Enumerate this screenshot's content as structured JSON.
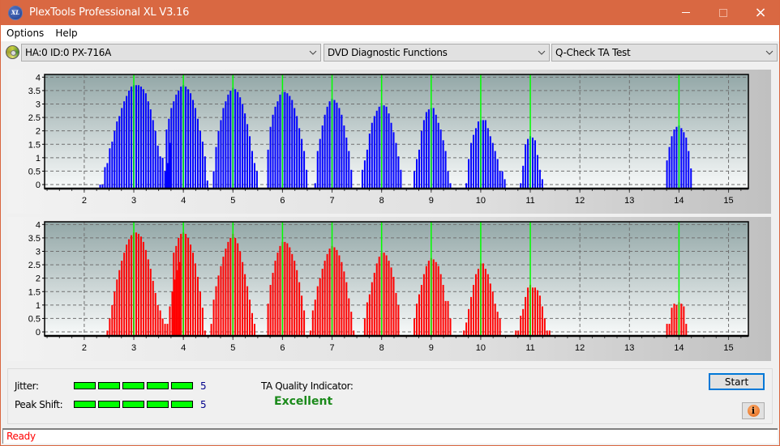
{
  "window": {
    "title": "PlexTools Professional XL V3.16",
    "icon": "xl-logo-icon",
    "app_icon_text": "XL",
    "controls": {
      "minimize": "minimize-icon",
      "maximize": "maximize-icon",
      "close": "×"
    }
  },
  "menu": {
    "items": [
      {
        "label": "Options"
      },
      {
        "label": "Help"
      }
    ]
  },
  "toolbar": {
    "drive_select": "HA:0 ID:0  PX-716A",
    "function_select": "DVD Diagnostic Functions",
    "test_select": "Q-Check TA Test"
  },
  "colors": {
    "titlebar": "#d96842",
    "land_bars": "#0000ff",
    "pit_bars": "#ff0000",
    "reference_lines": "#00ff00",
    "quality_text": "#1b8a1b",
    "status_text": "#ff0000",
    "meter_fill": "#00ff00"
  },
  "chart_data": [
    {
      "type": "bar",
      "name": "top-histogram",
      "color": "#0000ff",
      "xlim": [
        1.2,
        15.4
      ],
      "ylim": [
        -0.15,
        4.1
      ],
      "x_ticks": [
        2,
        3,
        4,
        5,
        6,
        7,
        8,
        9,
        10,
        11,
        12,
        13,
        14,
        15
      ],
      "y_ticks": [
        0,
        0.5,
        1,
        1.5,
        2,
        2.5,
        3,
        3.5,
        4
      ],
      "y_tick_labels": [
        "0",
        "0.5",
        "1",
        "1.5",
        "2",
        "2.5",
        "3",
        "3.5",
        "4"
      ],
      "reference_lines": [
        3,
        4,
        5,
        6,
        7,
        8,
        9,
        10,
        11,
        14
      ],
      "grid": true,
      "peaks": [
        {
          "center": 3.0,
          "values": [
            0,
            0,
            0.65,
            0.8,
            1.35,
            1.6,
            2.0,
            2.35,
            2.55,
            2.85,
            3.1,
            3.3,
            3.5,
            3.65,
            3.7,
            3.7,
            3.7,
            3.65,
            3.55,
            3.4,
            3.1,
            2.8,
            2.4,
            2.0,
            1.45,
            1.05,
            1.0,
            0.5,
            0.8,
            1.55
          ]
        },
        {
          "center": 4.0,
          "values": [
            2.05,
            2.45,
            2.85,
            3.1,
            3.35,
            3.5,
            3.65,
            3.7,
            3.65,
            3.55,
            3.4,
            3.15,
            2.85,
            2.45,
            2.0,
            1.6,
            1.05,
            0.15
          ]
        },
        {
          "center": 5.0,
          "values": [
            0.5,
            1.4,
            2.0,
            2.4,
            2.85,
            3.1,
            3.35,
            3.5,
            3.6,
            3.55,
            3.45,
            3.25,
            3.0,
            2.65,
            2.25,
            1.8,
            1.25,
            0.8,
            0.5
          ]
        },
        {
          "center": 6.0,
          "values": [
            1.3,
            2.15,
            2.6,
            2.9,
            3.1,
            3.35,
            3.45,
            3.45,
            3.4,
            3.3,
            3.15,
            2.85,
            2.55,
            2.1,
            1.7,
            1.25,
            0.55
          ]
        },
        {
          "center": 7.0,
          "values": [
            0.05,
            1.25,
            1.7,
            2.2,
            2.6,
            2.9,
            3.1,
            3.2,
            3.15,
            3.05,
            2.85,
            2.6,
            2.2,
            1.75,
            1.25,
            0.55
          ]
        },
        {
          "center": 8.0,
          "values": [
            0.55,
            0.9,
            1.3,
            1.9,
            2.3,
            2.55,
            2.75,
            2.9,
            2.95,
            2.95,
            2.9,
            2.65,
            2.3,
            1.95,
            1.55,
            1.05,
            0.55
          ]
        },
        {
          "center": 9.0,
          "values": [
            0.5,
            0.95,
            1.3,
            2.0,
            2.4,
            2.7,
            2.8,
            2.85,
            2.85,
            2.6,
            2.3,
            2.05,
            1.65,
            1.25,
            0.5,
            0.05
          ]
        },
        {
          "center": 10.0,
          "values": [
            0.05,
            0.95,
            1.55,
            1.85,
            2.1,
            2.35,
            2.4,
            2.4,
            2.4,
            2.1,
            1.8,
            1.55,
            1.25,
            0.95,
            0.5,
            0.5,
            0.2
          ]
        },
        {
          "center": 11.0,
          "values": [
            0.05,
            0.7,
            1.5,
            1.7,
            1.8,
            1.75,
            1.65,
            1.1,
            0.55,
            0.2
          ]
        },
        {
          "center": 14.0,
          "values": [
            0.9,
            1.4,
            1.8,
            2.05,
            2.15,
            2.2,
            2.1,
            1.95,
            1.75,
            1.25,
            0.6
          ]
        }
      ]
    },
    {
      "type": "bar",
      "name": "bottom-histogram",
      "color": "#ff0000",
      "xlim": [
        1.2,
        15.4
      ],
      "ylim": [
        -0.15,
        4.1
      ],
      "x_ticks": [
        2,
        3,
        4,
        5,
        6,
        7,
        8,
        9,
        10,
        11,
        12,
        13,
        14,
        15
      ],
      "y_ticks": [
        0,
        0.5,
        1,
        1.5,
        2,
        2.5,
        3,
        3.5,
        4
      ],
      "y_tick_labels": [
        "0",
        "0.5",
        "1",
        "1.5",
        "2",
        "2.5",
        "3",
        "3.5",
        "4"
      ],
      "reference_lines": [
        3,
        4,
        5,
        6,
        7,
        8,
        9,
        10,
        11,
        14
      ],
      "grid": true,
      "peaks": [
        {
          "center": 3.0,
          "values": [
            0.05,
            0.5,
            1.0,
            1.5,
            1.95,
            2.3,
            2.65,
            2.95,
            3.25,
            3.45,
            3.6,
            3.7,
            3.7,
            3.65,
            3.55,
            3.35,
            3.05,
            2.7,
            2.35,
            1.9,
            1.45,
            1.0,
            0.8,
            0.5,
            0.3,
            0.3,
            0.95,
            1.5,
            1.95,
            2.3,
            2.6
          ]
        },
        {
          "center": 4.0,
          "values": [
            2.95,
            3.2,
            3.5,
            3.65,
            3.7,
            3.65,
            3.5,
            3.25,
            2.95,
            2.55,
            2.05,
            1.5,
            0.9,
            0.05
          ]
        },
        {
          "center": 5.0,
          "values": [
            0.3,
            1.2,
            1.7,
            2.1,
            2.45,
            2.8,
            3.1,
            3.35,
            3.5,
            3.65,
            3.5,
            3.3,
            3.0,
            2.6,
            2.15,
            1.7,
            1.2,
            0.7,
            0.3
          ]
        },
        {
          "center": 6.0,
          "values": [
            1.05,
            1.75,
            2.2,
            2.65,
            2.95,
            3.2,
            3.35,
            3.35,
            3.3,
            3.15,
            2.9,
            2.65,
            2.3,
            1.85,
            1.35,
            0.8
          ]
        },
        {
          "center": 7.0,
          "values": [
            0.05,
            0.8,
            1.2,
            1.7,
            2.0,
            2.35,
            2.65,
            2.9,
            3.1,
            3.2,
            3.15,
            3.05,
            2.85,
            2.6,
            2.25,
            1.85,
            1.25,
            0.75,
            0.05
          ]
        },
        {
          "center": 8.0,
          "values": [
            0.5,
            1.1,
            1.4,
            1.85,
            2.2,
            2.55,
            2.8,
            2.95,
            2.95,
            2.85,
            2.65,
            2.4,
            2.05,
            1.45,
            1.0
          ]
        },
        {
          "center": 9.0,
          "values": [
            0.5,
            1.05,
            1.4,
            1.75,
            2.15,
            2.45,
            2.65,
            2.75,
            2.7,
            2.6,
            2.45,
            2.15,
            1.75,
            1.15,
            1.15,
            0.5
          ]
        },
        {
          "center": 10.0,
          "values": [
            0.05,
            0.35,
            0.85,
            1.3,
            1.75,
            2.15,
            2.35,
            2.55,
            2.55,
            2.35,
            2.15,
            1.8,
            1.5,
            1.05,
            0.75,
            0.5
          ]
        },
        {
          "center": 11.0,
          "values": [
            0.05,
            0.05,
            0.6,
            0.85,
            1.3,
            1.65,
            1.75,
            1.65,
            1.65,
            1.55,
            1.35,
            0.95,
            0.5,
            0.05,
            0.05
          ]
        },
        {
          "center": 14.0,
          "values": [
            0.3,
            0.3,
            0.9,
            1.05,
            1.0,
            1.1,
            1.05,
            0.95,
            0.3
          ]
        }
      ]
    }
  ],
  "results": {
    "jitter_label": "Jitter:",
    "jitter_value": "5",
    "jitter_level": 5,
    "jitter_max": 5,
    "peak_shift_label": "Peak Shift:",
    "peak_shift_value": "5",
    "peak_shift_level": 5,
    "peak_shift_max": 5,
    "ta_quality_label": "TA Quality Indicator:",
    "ta_quality_value": "Excellent"
  },
  "buttons": {
    "start": "Start",
    "info_icon": "i"
  },
  "status": {
    "text": "Ready"
  }
}
